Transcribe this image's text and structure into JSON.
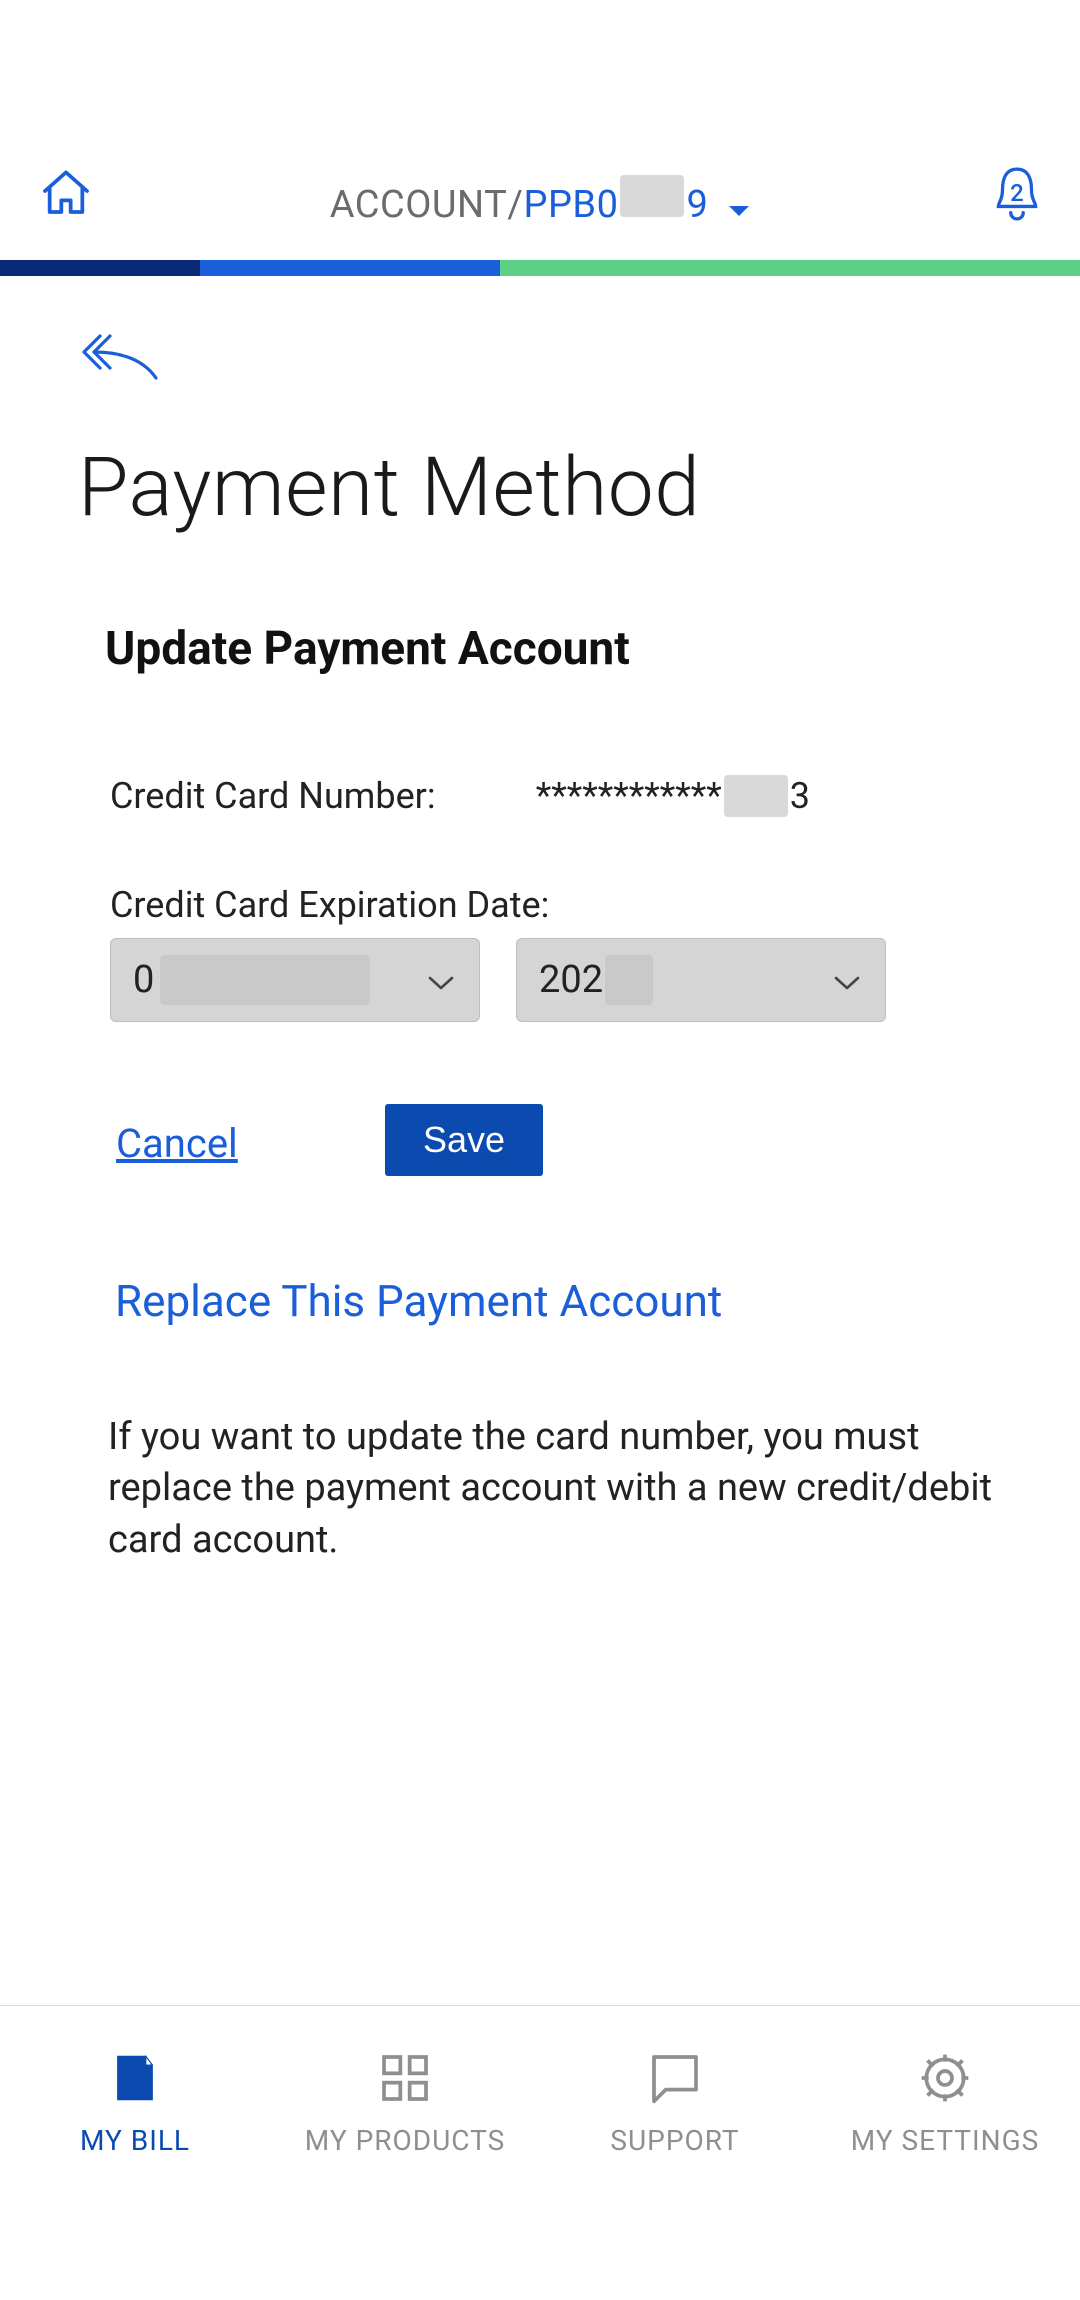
{
  "header": {
    "breadcrumb_prefix": "ACCOUNT/",
    "account_no_prefix": "PPB0",
    "account_no_suffix": "9",
    "notification_count": "2"
  },
  "page": {
    "title": "Payment Method",
    "subtitle": "Update Payment Account"
  },
  "fields": {
    "cc_label": "Credit Card Number:",
    "cc_mask": "************",
    "cc_last": "3",
    "exp_label": "Credit Card Expiration Date:",
    "month_value": "0",
    "year_value": "202"
  },
  "actions": {
    "cancel": "Cancel",
    "save": "Save",
    "replace": "Replace This Payment Account"
  },
  "note": "If you want to update the card number, you must replace the payment account with a new credit/debit card account.",
  "tabs": {
    "bill": "MY BILL",
    "products": "MY PRODUCTS",
    "support": "SUPPORT",
    "settings": "MY SETTINGS"
  }
}
